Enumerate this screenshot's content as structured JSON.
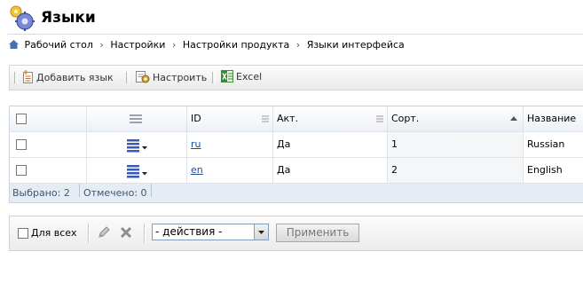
{
  "page": {
    "title": "Языки"
  },
  "breadcrumb": {
    "items": [
      "Рабочий стол",
      "Настройки",
      "Настройки продукта",
      "Языки интерфейса"
    ],
    "separator": "›"
  },
  "toolbar": {
    "add_label": "Добавить язык",
    "settings_label": "Настроить",
    "excel_label": "Excel"
  },
  "grid": {
    "columns": [
      "",
      "",
      "ID",
      "Акт.",
      "Сорт.",
      "Название"
    ],
    "sorted_column": "Сорт.",
    "sort_direction": "asc",
    "rows": [
      {
        "id": "ru",
        "active": "Да",
        "sort": "1",
        "name": "Russian"
      },
      {
        "id": "en",
        "active": "Да",
        "sort": "2",
        "name": "English"
      }
    ],
    "footer": {
      "selected": "Выбрано: 2",
      "checked": "Отмечено: 0"
    }
  },
  "action_bar": {
    "for_all_label": "Для всех",
    "actions_select": "- действия -",
    "apply_label": "Применить"
  },
  "icons": {
    "title": "gear-icon",
    "home": "home-icon",
    "add": "add-document-icon",
    "settings": "settings-icon",
    "excel": "excel-icon",
    "edit": "pencil-icon",
    "delete": "delete-icon"
  },
  "colors": {
    "link": "#1a4d9c",
    "accent": "#3e5576"
  }
}
